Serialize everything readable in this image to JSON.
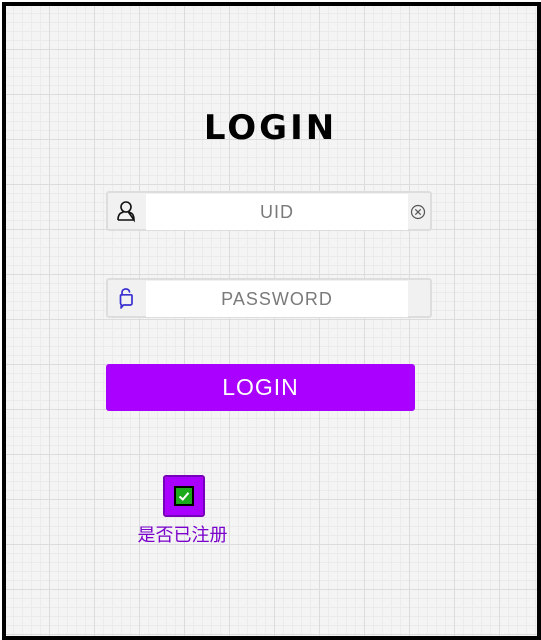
{
  "form": {
    "title": "LOGIN",
    "uid_placeholder": "UID",
    "password_placeholder": "PASSWORD",
    "login_button": "LOGIN",
    "registered_checked": true,
    "registered_label": "是否已注册"
  },
  "icons": {
    "user": "user-icon",
    "lock": "lock-icon",
    "clear": "clear-icon",
    "check": "checkmark-icon"
  },
  "colors": {
    "accent": "#aa00ff",
    "check_green": "#1aaa1a",
    "label_purple": "#7a00cc"
  }
}
